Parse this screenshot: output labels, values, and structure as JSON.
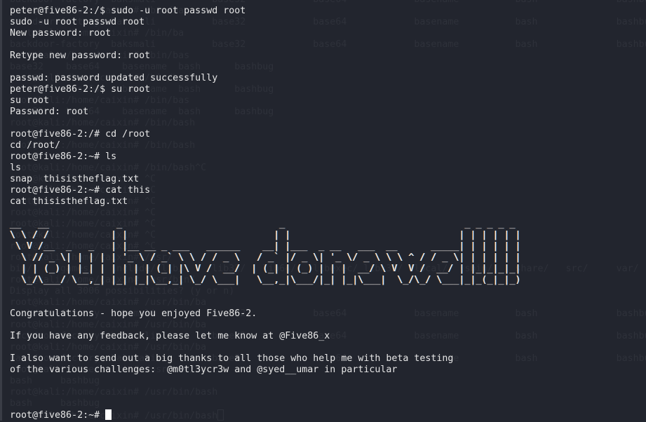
{
  "colors": {
    "background": "#22252e",
    "text": "#e6e6e6",
    "ghost_text": "#2e313a",
    "cursor": "#ffffff"
  },
  "background_ghost": {
    "lines": [
      "backdoor-factory  baksmali          base32            base64            basename          bash              bashbug",
      "root@kali:/home/caixin# /bin/ba",
      "backdoor-factory  baksmali          base32            base64            basename          bash              bashbug",
      "root@kali:/home/caixin# /bin/ba",
      "backdoor-factory  baksmali          base32            base64            basename          bash              bashbug",
      "root@kali:/home/caixin# /bin/bas",
      "base32    base64    basename  bash      bashbug",
      "root@kali:/home/caixin# /bin/bas",
      "base32    base64    basename  bash      bashbug",
      "root@kali:/home/caixin# /bin/bas",
      "base32    base64    basename  bash      bashbug",
      "root@kali:/home/caixin# /bin/bash",
      "",
      "root@kali:/home/caixin# /bin/bash",
      "",
      "root@kali:/home/caixin# /bin/bash^C",
      "root@kali:/home/caixin# ^C",
      "root@kali:/home/caixin# ^C",
      "root@kali:/home/caixin# ^C",
      "root@kali:/home/caixin# ^C",
      "root@kali:/home/caixin# ^C",
      "root@kali:/home/caixin# ^C",
      "root@kali:/home/caixin# ^C",
      "root@kali:/home/caixin# /usr/",
      "bin/     games/   include/ lib/     lib32/   lib64/   libexec/ libx32/  local/   sbin/    share/   src/     var/",
      "root@kali:/home/caixin# /usr/bin/",
      "Display all 3006 possibilities? (y or n)",
      "root@kali:/home/caixin# /usr/bin/ba",
      "backdoor-factory  baksmali          base32            base64            basename          bash              bashbug",
      "root@kali:/home/caixin# /usr/bin/ba",
      "backdoor-factory  baksmali          base32            base64            basename          bash              bashbug",
      "root@kali:/home/caixin# /usr/bin/ba",
      "backdoor-factory  baksmali          base32            base64            basename          bash              bashbug",
      "root@kali:/home/caixin# /usr/bin/ba",
      "bash     bashbug",
      "root@kali:/home/caixin# /usr/bin/bash",
      "bash     bashbug",
      "root@kali:/home/caixin# /usr/bin/bash"
    ]
  },
  "terminal": {
    "output_lines": [
      "peter@five86-2:/$ sudo -u root passwd root",
      "sudo -u root passwd root",
      "New password: root",
      "",
      "Retype new password: root",
      "",
      "passwd: password updated successfully",
      "peter@five86-2:/$ su root",
      "su root",
      "Password: root",
      "",
      "root@five86-2:/# cd /root",
      "cd /root/",
      "root@five86-2:~# ls",
      "ls",
      "snap  thisistheflag.txt",
      "root@five86-2:~# cat this",
      "cat thisistheflag.txt"
    ],
    "ascii_art": [
      "__   __            _                            _                                _ _ _ _ _",
      "\\ \\ / /           | |                          | |                              | | | | | |",
      " \\ V /__  _   _   | |__ __ _ ___   ______    __| |___  _ __   ___  __      _____| | | | | |",
      "  \\ // _ \\| | | | | '_ \\ / _` \\ \\ / / _ \\   / _` |/ _ \\| '_ \\/ _ \\ \\ \\ ^ / / _ \\| | | | | |",
      "  | | (_) | |_| | | | | | (_| |\\ V /  __/  | (_| | (_) | | |  __/ \\ V  V /  __/ | |_|_|_|_|",
      "  \\_/\\___/ \\__,_| |_| |_|\\__,_| \\_/ \\___|   \\__,_|\\___/|_| |_|\\___|  \\_/\\_/ \\___|_|_(_|_|_)"
    ],
    "message_lines": [
      "Congratulations - hope you enjoyed Five86-2.",
      "",
      "If you have any feedback, please let me know at @Five86_x",
      "",
      "I also want to send out a big thanks to all those who help me with beta testing",
      "of the various challenges:  @m0tl3ycr3w and @syed__umar in particular",
      "",
      "",
      ""
    ],
    "prompt": "root@five86-2:~# "
  }
}
